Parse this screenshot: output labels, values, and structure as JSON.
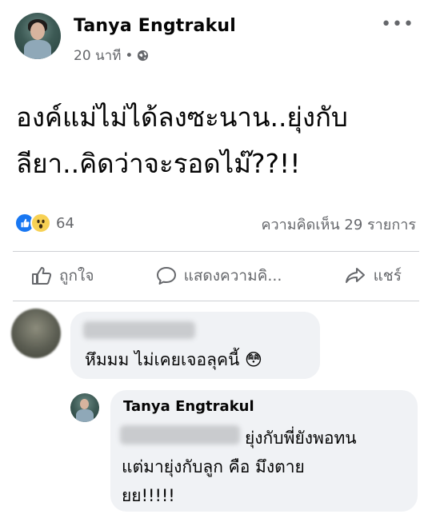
{
  "post": {
    "author": "Tanya Engtrakul",
    "timestamp": "20 นาที",
    "separator": "•",
    "privacy_icon": "globe-icon",
    "text_line1": "องค์แม่ไม่ได้ลงซะนาน..ยุ่งกับ",
    "text_line2": "ลียา..คิดว่าจะรอดไม๊??!!"
  },
  "reactions": {
    "count": "64",
    "types": [
      "like",
      "wow"
    ]
  },
  "comments_summary": "ความคิดเห็น 29 รายการ",
  "actions": {
    "like": "ถูกใจ",
    "comment": "แสดงความคิ...",
    "share": "แชร์"
  },
  "comments": [
    {
      "text": "หึมมม ไม่เคยเจอลุคนี้",
      "emoji": "😳"
    },
    {
      "author": "Tanya Engtrakul",
      "line1": "ยุ่งกับพี่ยังพอทน",
      "line2": "แต่มายุ่งกับลูก คือ มึงตาย",
      "line3": "ยย!!!!!"
    }
  ],
  "colors": {
    "accent": "#1877f2",
    "muted": "#65676b",
    "bubble": "#f0f2f5"
  }
}
